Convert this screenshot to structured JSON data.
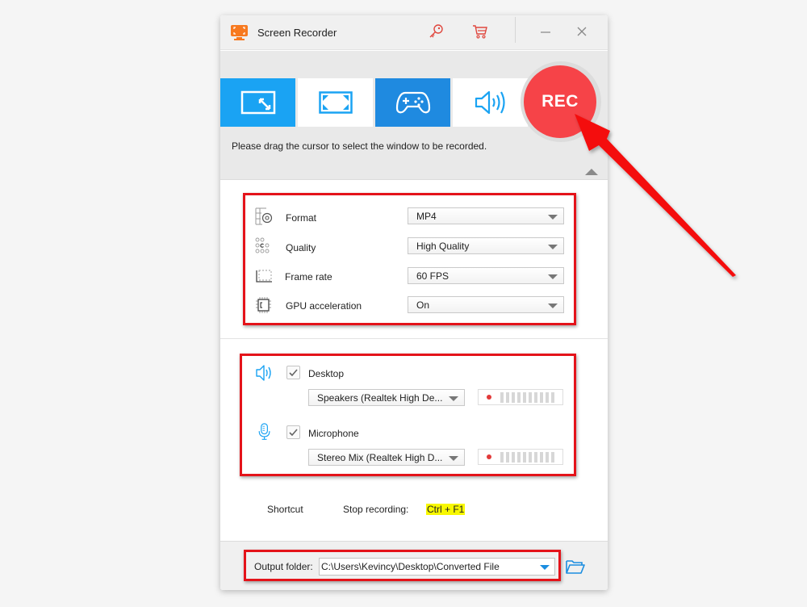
{
  "window": {
    "title": "Screen Recorder",
    "titlebar_icons": [
      "key-icon",
      "cart-icon",
      "minimize-icon",
      "close-icon"
    ]
  },
  "modes": [
    {
      "name": "region",
      "icon": "region-select-icon",
      "selected": true
    },
    {
      "name": "fullscreen",
      "icon": "fullscreen-icon",
      "selected": false
    },
    {
      "name": "game",
      "icon": "gamepad-icon",
      "selected": true
    },
    {
      "name": "audio-only",
      "icon": "speaker-icon",
      "selected": false
    }
  ],
  "rec_button": {
    "label": "REC"
  },
  "hint": "Please drag the cursor to select the window to be recorded.",
  "video_settings": [
    {
      "label": "Format",
      "icon": "format-settings-icon",
      "value": "MP4"
    },
    {
      "label": "Quality",
      "icon": "quality-dots-icon",
      "value": "High Quality"
    },
    {
      "label": "Frame rate",
      "icon": "frame-rate-icon",
      "value": "60 FPS"
    },
    {
      "label": "GPU acceleration",
      "icon": "gpu-chip-icon",
      "value": "On"
    }
  ],
  "audio": {
    "desktop": {
      "label": "Desktop",
      "checked": true,
      "device": "Speakers (Realtek High De...",
      "level": 0
    },
    "microphone": {
      "label": "Microphone",
      "checked": true,
      "device": "Stereo Mix (Realtek High D...",
      "level": 0
    }
  },
  "shortcut": {
    "label": "Shortcut",
    "action": "Stop recording:",
    "keys": "Ctrl + F1"
  },
  "output": {
    "label": "Output folder:",
    "path": "C:\\Users\\Kevincy\\Desktop\\Converted File"
  },
  "colors": {
    "accent_blue": "#1aa3f3",
    "rec_red": "#f64348",
    "annotation_red": "#e4131a",
    "shortcut_highlight": "#f7f700"
  }
}
